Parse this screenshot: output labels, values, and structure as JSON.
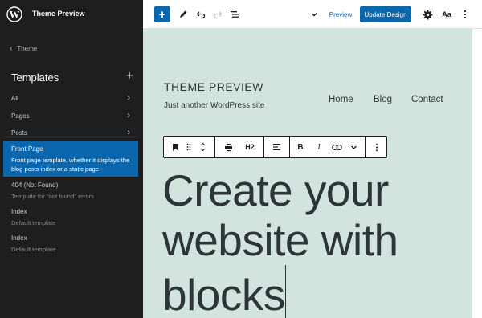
{
  "site": {
    "title": "Theme Preview"
  },
  "sidebar": {
    "back_label": "Theme",
    "section_title": "Templates",
    "nav": [
      {
        "label": "All"
      },
      {
        "label": "Pages"
      },
      {
        "label": "Posts"
      }
    ],
    "active_template": {
      "title": "Front Page",
      "description": "Front page template, whether it displays the blog posts index or a static page"
    },
    "templates": [
      {
        "title": "404 (Not Found)",
        "description": "Template for \"not found\" errors"
      },
      {
        "title": "Index",
        "description": "Default template"
      },
      {
        "title": "Index",
        "description": "Default template"
      }
    ]
  },
  "toolbar": {
    "preview_label": "Preview",
    "update_label": "Update Design",
    "styles_label": "Aa"
  },
  "canvas": {
    "theme_title": "THEME PREVIEW",
    "tagline": "Just another WordPress site",
    "nav": [
      "Home",
      "Blog",
      "Contact"
    ],
    "heading_level": "H2",
    "headline_lines": [
      "Create your",
      "website with",
      "blocks"
    ]
  },
  "colors": {
    "accent": "#0a66ad",
    "sidebar_bg": "#1e1e1e",
    "canvas_bg": "#d2e4dd"
  }
}
